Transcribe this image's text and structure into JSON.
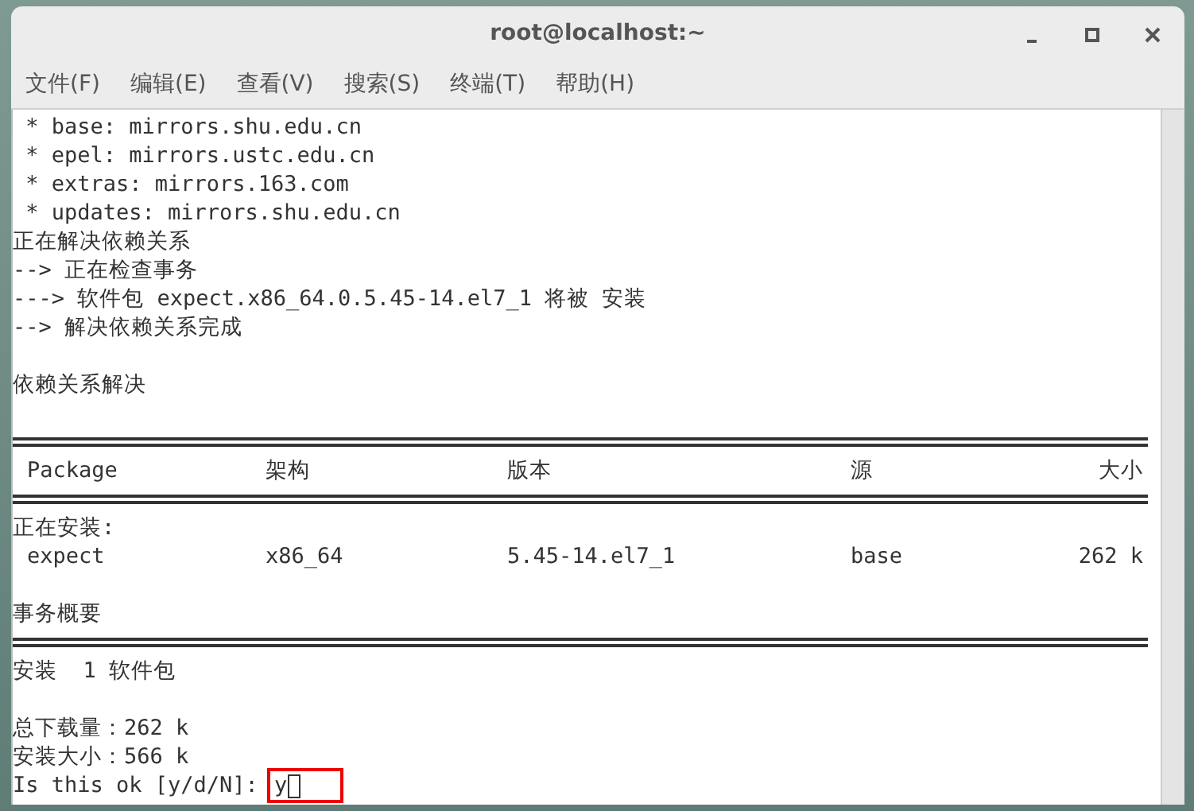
{
  "window": {
    "title": "root@localhost:~"
  },
  "menu": [
    "文件(F)",
    "编辑(E)",
    "查看(V)",
    "搜索(S)",
    "终端(T)",
    "帮助(H)"
  ],
  "lines": [
    {
      "kind": "text",
      "text": " * base: mirrors.shu.edu.cn"
    },
    {
      "kind": "text",
      "text": " * epel: mirrors.ustc.edu.cn"
    },
    {
      "kind": "text",
      "text": " * extras: mirrors.163.com"
    },
    {
      "kind": "text",
      "text": " * updates: mirrors.shu.edu.cn"
    },
    {
      "kind": "text",
      "text": "正在解决依赖关系"
    },
    {
      "kind": "text",
      "text": "--> 正在检查事务"
    },
    {
      "kind": "text",
      "text": "---> 软件包 expect.x86_64.0.5.45-14.el7_1 将被 安装"
    },
    {
      "kind": "text",
      "text": "--> 解决依赖关系完成"
    },
    {
      "kind": "blank"
    },
    {
      "kind": "text",
      "text": "依赖关系解决"
    },
    {
      "kind": "blank"
    },
    {
      "kind": "rule"
    },
    {
      "kind": "header",
      "cells": [
        "Package",
        "架构",
        "版本",
        "源",
        "大小"
      ]
    },
    {
      "kind": "rule"
    },
    {
      "kind": "text",
      "text": "正在安装:"
    },
    {
      "kind": "row",
      "cells": [
        "expect",
        "x86_64",
        "5.45-14.el7_1",
        "base",
        "262 k"
      ]
    },
    {
      "kind": "blank"
    },
    {
      "kind": "text",
      "text": "事务概要"
    },
    {
      "kind": "rule"
    },
    {
      "kind": "text",
      "text": "安装  1 软件包"
    },
    {
      "kind": "blank"
    },
    {
      "kind": "text",
      "text": "总下载量：262 k"
    },
    {
      "kind": "text",
      "text": "安装大小：566 k"
    },
    {
      "kind": "prompt",
      "text": "Is this ok [y/d/N]:",
      "value": "y"
    }
  ]
}
